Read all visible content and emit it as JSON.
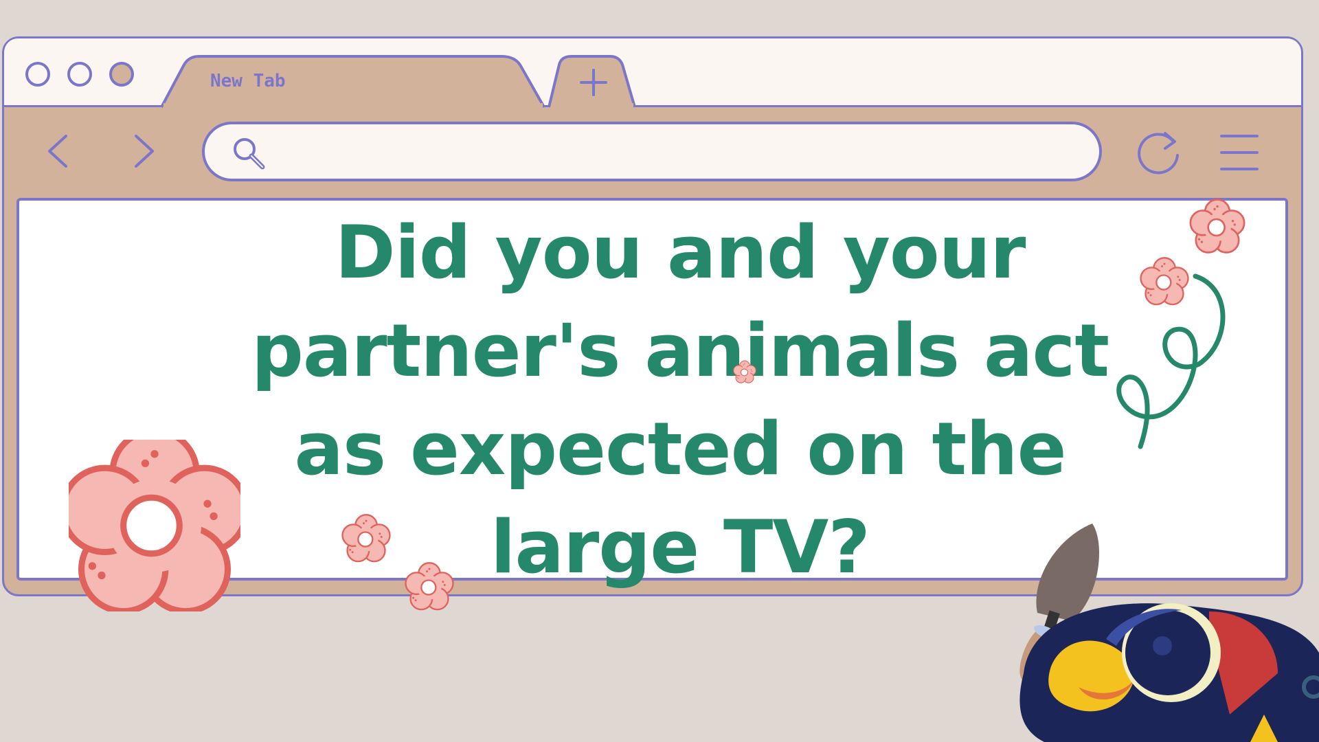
{
  "browser": {
    "tab": {
      "label": "New Tab"
    },
    "new_tab_icon": "plus-icon",
    "nav": {
      "back_icon": "chevron-left-icon",
      "forward_icon": "chevron-right-icon",
      "reload_icon": "reload-icon",
      "menu_icon": "hamburger-menu-icon"
    },
    "address_bar": {
      "value": "",
      "placeholder": "",
      "icon": "search-icon"
    }
  },
  "slide": {
    "title_lines": [
      "Did you and your",
      "partner's animals act",
      "as expected on the",
      "large TV?"
    ]
  },
  "colors": {
    "background": "#dfd7d1",
    "frame_fill": "#d3b29b",
    "frame_stroke": "#7b76c9",
    "title_text": "#26886a",
    "flower_fill": "#f6b8b3",
    "flower_stroke": "#e0625c"
  }
}
